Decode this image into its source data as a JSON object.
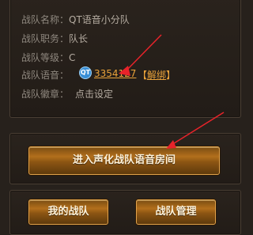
{
  "team_info": {
    "name_label": "战队名称：",
    "name_value": "QT语音小分队",
    "role_label": "战队职务：",
    "role_value": "队长",
    "level_label": "战队等级：",
    "level_value": "C",
    "voice_label": "战队语音：",
    "voice_icon": "qt-voice-icon",
    "voice_number": "3354127",
    "unbind_open": "【",
    "unbind_label": "解绑",
    "unbind_close": "】",
    "badge_label": "战队徽章：",
    "badge_value": "点击设定"
  },
  "buttons": {
    "enter_voice_room": "进入声化战队语音房间",
    "my_team": "我的战队",
    "team_manage": "战队管理"
  },
  "colors": {
    "accent_orange": "#e9a23a",
    "annotation_red": "#e8232a",
    "button_border": "#e0a14b"
  }
}
